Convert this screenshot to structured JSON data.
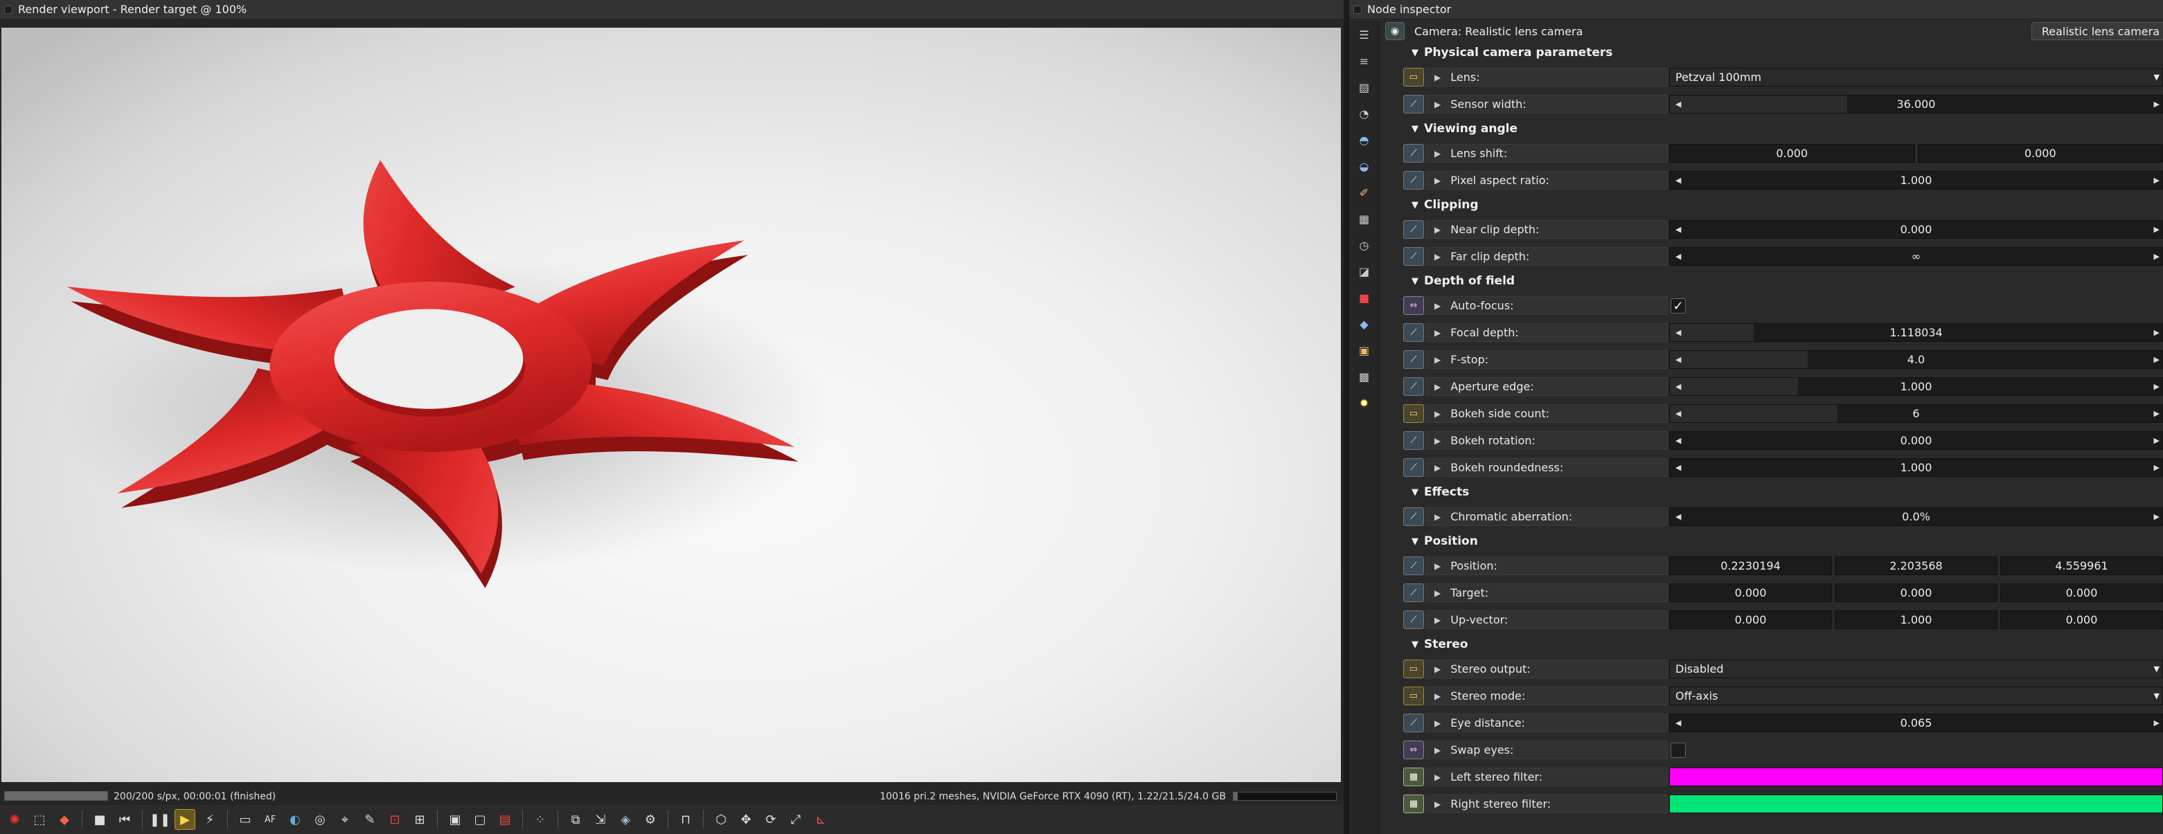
{
  "viewport": {
    "title": "Render viewport - Render target @ 100%",
    "status": "200/200 s/px, 00:00:01 (finished)",
    "progress_fraction": 1.0,
    "gpu_info": "10016 pri.2 meshes, NVIDIA GeForce RTX 4090 (RT), 1.22/21.5/24.0 GB"
  },
  "toolbar": {
    "icons": [
      "octane-logo-icon",
      "region-icon",
      "color-cube-icon",
      "stop-icon",
      "restart-icon",
      "pause-icon",
      "play-icon",
      "lightning-icon",
      "monitor-icon",
      "af-icon",
      "color-picker-icon",
      "material-picker-icon",
      "object-picker-icon",
      "light-picker-icon",
      "focus-picker-icon",
      "camera-icon",
      "viewport-icon",
      "clay-icon",
      "picker-icon",
      "layers-icon",
      "export-icon",
      "import-icon",
      "lock-icon",
      "cube-icon",
      "move-icon",
      "rotate-icon",
      "fit-icon",
      "axis-icon"
    ]
  },
  "inspector": {
    "title": "Node inspector",
    "node_name": "Camera: Realistic lens camera",
    "node_type": "Realistic lens camera",
    "sections": {
      "physical": "Physical camera parameters",
      "viewing": "Viewing angle",
      "clipping": "Clipping",
      "dof": "Depth of field",
      "effects": "Effects",
      "position": "Position",
      "stereo": "Stereo"
    },
    "params": {
      "lens": {
        "label": "Lens:",
        "value": "Petzval 100mm"
      },
      "sensor_width": {
        "label": "Sensor width:",
        "value": "36.000"
      },
      "lens_shift": {
        "label": "Lens shift:",
        "x": "0.000",
        "y": "0.000"
      },
      "pixel_aspect": {
        "label": "Pixel aspect ratio:",
        "value": "1.000"
      },
      "near_clip": {
        "label": "Near clip depth:",
        "value": "0.000"
      },
      "far_clip": {
        "label": "Far clip depth:",
        "value": "∞"
      },
      "auto_focus": {
        "label": "Auto-focus:",
        "checked": "✓"
      },
      "focal_depth": {
        "label": "Focal depth:",
        "value": "1.118034"
      },
      "fstop": {
        "label": "F-stop:",
        "value": "4.0"
      },
      "aperture_edge": {
        "label": "Aperture edge:",
        "value": "1.000"
      },
      "bokeh_sides": {
        "label": "Bokeh side count:",
        "value": "6"
      },
      "bokeh_rotation": {
        "label": "Bokeh rotation:",
        "value": "0.000"
      },
      "bokeh_roundness": {
        "label": "Bokeh roundedness:",
        "value": "1.000"
      },
      "chromatic": {
        "label": "Chromatic aberration:",
        "value": "0.0%"
      },
      "position": {
        "label": "Position:",
        "x": "0.2230194",
        "y": "2.203568",
        "z": "4.559961"
      },
      "target": {
        "label": "Target:",
        "x": "0.000",
        "y": "0.000",
        "z": "0.000"
      },
      "up_vector": {
        "label": "Up-vector:",
        "x": "0.000",
        "y": "1.000",
        "z": "0.000"
      },
      "stereo_output": {
        "label": "Stereo output:",
        "value": "Disabled"
      },
      "stereo_mode": {
        "label": "Stereo mode:",
        "value": "Off-axis"
      },
      "eye_distance": {
        "label": "Eye distance:",
        "value": "0.065"
      },
      "swap_eyes": {
        "label": "Swap eyes:"
      },
      "left_filter": {
        "label": "Left stereo filter:",
        "color": "#ff00ff"
      },
      "right_filter": {
        "label": "Right stereo filter:",
        "color": "#00e676"
      }
    }
  },
  "colors": {
    "logo_red": "#e02020",
    "accent_yellow": "#ffd34a"
  }
}
